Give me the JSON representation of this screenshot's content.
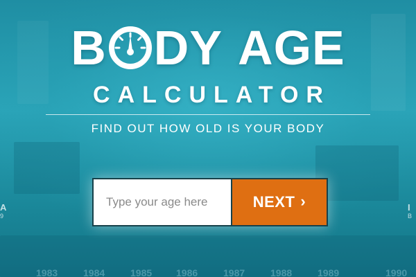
{
  "header": {
    "title_word1": "BODY",
    "title_word1_o_icon": "speedometer-gauge-icon",
    "title_word2": "AGE",
    "subtitle": "CALCULATOR",
    "tagline": "FIND OUT HOW OLD IS YOUR BODY"
  },
  "form": {
    "age_placeholder": "Type your age here",
    "age_value": "",
    "next_label": "NEXT",
    "next_icon": "chevron-right-icon"
  },
  "side_labels": {
    "left": {
      "label": "A",
      "sub": "9"
    },
    "right": {
      "label": "I",
      "sub": "B"
    }
  },
  "year_strip": [
    "1983",
    "1984",
    "1985",
    "1986",
    "1987",
    "1988",
    "1989",
    "1990"
  ],
  "colors": {
    "background": "#1b8fa3",
    "next_button": "#df6f12",
    "text": "#ffffff"
  }
}
